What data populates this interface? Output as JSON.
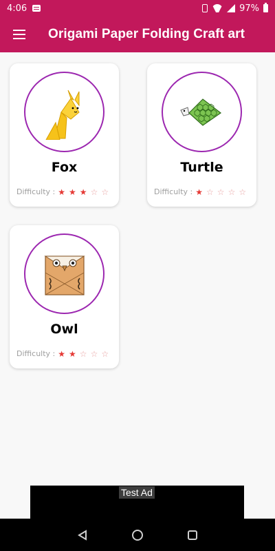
{
  "status_bar": {
    "time": "4:06",
    "battery_percent": "97%"
  },
  "app_bar": {
    "title": "Origami Paper Folding Craft art"
  },
  "difficulty_label": "Difficulty :",
  "cards": [
    {
      "name": "Fox",
      "icon": "fox-origami-icon",
      "difficulty": 3,
      "max": 5
    },
    {
      "name": "Turtle",
      "icon": "turtle-origami-icon",
      "difficulty": 1,
      "max": 5
    },
    {
      "name": "Owl",
      "icon": "owl-origami-icon",
      "difficulty": 2,
      "max": 5
    }
  ],
  "ad": {
    "label": "Test Ad"
  },
  "colors": {
    "primary": "#c2185b",
    "circle_border": "#9c27b0",
    "star": "#e53935"
  }
}
